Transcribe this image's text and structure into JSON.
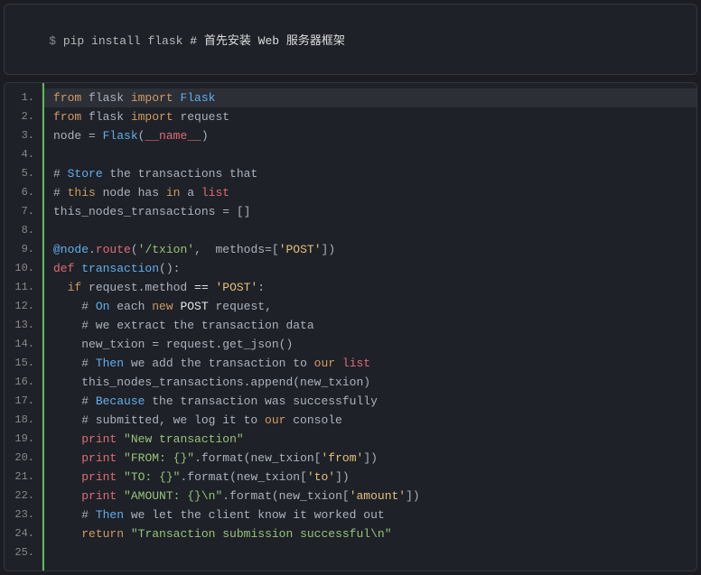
{
  "command": {
    "prompt": "$ ",
    "text": "pip install flask ",
    "comment": "# 首先安装 Web 服务器框架"
  },
  "code": {
    "highlight_line": 1,
    "lines": [
      [
        {
          "t": "from",
          "c": "tok-orange"
        },
        {
          "t": " flask ",
          "c": "tok-plain"
        },
        {
          "t": "import",
          "c": "tok-orange"
        },
        {
          "t": " ",
          "c": "tok-plain"
        },
        {
          "t": "Flask",
          "c": "tok-blue"
        }
      ],
      [
        {
          "t": "from",
          "c": "tok-orange"
        },
        {
          "t": " flask ",
          "c": "tok-plain"
        },
        {
          "t": "import",
          "c": "tok-orange"
        },
        {
          "t": " request",
          "c": "tok-plain"
        }
      ],
      [
        {
          "t": "node = ",
          "c": "tok-plain"
        },
        {
          "t": "Flask",
          "c": "tok-blue"
        },
        {
          "t": "(",
          "c": "tok-plain"
        },
        {
          "t": "__name__",
          "c": "tok-red"
        },
        {
          "t": ")",
          "c": "tok-plain"
        }
      ],
      [],
      [
        {
          "t": "# ",
          "c": "tok-plain"
        },
        {
          "t": "Store",
          "c": "tok-blue"
        },
        {
          "t": " the transactions that",
          "c": "tok-plain"
        }
      ],
      [
        {
          "t": "# ",
          "c": "tok-plain"
        },
        {
          "t": "this",
          "c": "tok-orange"
        },
        {
          "t": " node has ",
          "c": "tok-plain"
        },
        {
          "t": "in",
          "c": "tok-orange"
        },
        {
          "t": " a ",
          "c": "tok-plain"
        },
        {
          "t": "list",
          "c": "tok-red"
        }
      ],
      [
        {
          "t": "this_nodes_transactions = []",
          "c": "tok-plain"
        }
      ],
      [],
      [
        {
          "t": "@node",
          "c": "tok-blue"
        },
        {
          "t": ".",
          "c": "tok-plain"
        },
        {
          "t": "route",
          "c": "tok-red"
        },
        {
          "t": "(",
          "c": "tok-plain"
        },
        {
          "t": "'/txion'",
          "c": "tok-green"
        },
        {
          "t": ",  methods=[",
          "c": "tok-plain"
        },
        {
          "t": "'POST'",
          "c": "tok-str-y"
        },
        {
          "t": "])",
          "c": "tok-plain"
        }
      ],
      [
        {
          "t": "def",
          "c": "tok-red"
        },
        {
          "t": " ",
          "c": "tok-plain"
        },
        {
          "t": "transaction",
          "c": "tok-blue"
        },
        {
          "t": "():",
          "c": "tok-plain"
        }
      ],
      [
        {
          "t": "  ",
          "c": "tok-plain"
        },
        {
          "t": "if",
          "c": "tok-orange"
        },
        {
          "t": " request.method ",
          "c": "tok-plain"
        },
        {
          "t": "==",
          "c": "tok-white"
        },
        {
          "t": " ",
          "c": "tok-plain"
        },
        {
          "t": "'POST'",
          "c": "tok-str-y"
        },
        {
          "t": ":",
          "c": "tok-plain"
        }
      ],
      [
        {
          "t": "    # ",
          "c": "tok-plain"
        },
        {
          "t": "On",
          "c": "tok-blue"
        },
        {
          "t": " each ",
          "c": "tok-plain"
        },
        {
          "t": "new",
          "c": "tok-orange"
        },
        {
          "t": " ",
          "c": "tok-plain"
        },
        {
          "t": "POST",
          "c": "tok-white"
        },
        {
          "t": " request,",
          "c": "tok-plain"
        }
      ],
      [
        {
          "t": "    # we extract the transaction data",
          "c": "tok-plain"
        }
      ],
      [
        {
          "t": "    new_txion = request.get_json()",
          "c": "tok-plain"
        }
      ],
      [
        {
          "t": "    # ",
          "c": "tok-plain"
        },
        {
          "t": "Then",
          "c": "tok-blue"
        },
        {
          "t": " we add the transaction to ",
          "c": "tok-plain"
        },
        {
          "t": "our",
          "c": "tok-orange"
        },
        {
          "t": " ",
          "c": "tok-plain"
        },
        {
          "t": "list",
          "c": "tok-red"
        }
      ],
      [
        {
          "t": "    this_nodes_transactions.append(new_txion)",
          "c": "tok-plain"
        }
      ],
      [
        {
          "t": "    # ",
          "c": "tok-plain"
        },
        {
          "t": "Because",
          "c": "tok-blue"
        },
        {
          "t": " the transaction was successfully",
          "c": "tok-plain"
        }
      ],
      [
        {
          "t": "    # submitted, we log it to ",
          "c": "tok-plain"
        },
        {
          "t": "our",
          "c": "tok-orange"
        },
        {
          "t": " console",
          "c": "tok-plain"
        }
      ],
      [
        {
          "t": "    ",
          "c": "tok-plain"
        },
        {
          "t": "print",
          "c": "tok-red"
        },
        {
          "t": " ",
          "c": "tok-plain"
        },
        {
          "t": "\"New transaction\"",
          "c": "tok-green"
        }
      ],
      [
        {
          "t": "    ",
          "c": "tok-plain"
        },
        {
          "t": "print",
          "c": "tok-red"
        },
        {
          "t": " ",
          "c": "tok-plain"
        },
        {
          "t": "\"FROM: {}\"",
          "c": "tok-green"
        },
        {
          "t": ".format(new_txion[",
          "c": "tok-plain"
        },
        {
          "t": "'from'",
          "c": "tok-str-y"
        },
        {
          "t": "])",
          "c": "tok-plain"
        }
      ],
      [
        {
          "t": "    ",
          "c": "tok-plain"
        },
        {
          "t": "print",
          "c": "tok-red"
        },
        {
          "t": " ",
          "c": "tok-plain"
        },
        {
          "t": "\"TO: {}\"",
          "c": "tok-green"
        },
        {
          "t": ".format(new_txion[",
          "c": "tok-plain"
        },
        {
          "t": "'to'",
          "c": "tok-str-y"
        },
        {
          "t": "])",
          "c": "tok-plain"
        }
      ],
      [
        {
          "t": "    ",
          "c": "tok-plain"
        },
        {
          "t": "print",
          "c": "tok-red"
        },
        {
          "t": " ",
          "c": "tok-plain"
        },
        {
          "t": "\"AMOUNT: {}\\n\"",
          "c": "tok-green"
        },
        {
          "t": ".format(new_txion[",
          "c": "tok-plain"
        },
        {
          "t": "'amount'",
          "c": "tok-str-y"
        },
        {
          "t": "])",
          "c": "tok-plain"
        }
      ],
      [
        {
          "t": "    # ",
          "c": "tok-plain"
        },
        {
          "t": "Then",
          "c": "tok-blue"
        },
        {
          "t": " we let the client know it worked out",
          "c": "tok-plain"
        }
      ],
      [
        {
          "t": "    ",
          "c": "tok-plain"
        },
        {
          "t": "return",
          "c": "tok-orange"
        },
        {
          "t": " ",
          "c": "tok-plain"
        },
        {
          "t": "\"Transaction submission successful\\n\"",
          "c": "tok-green"
        }
      ],
      []
    ]
  }
}
